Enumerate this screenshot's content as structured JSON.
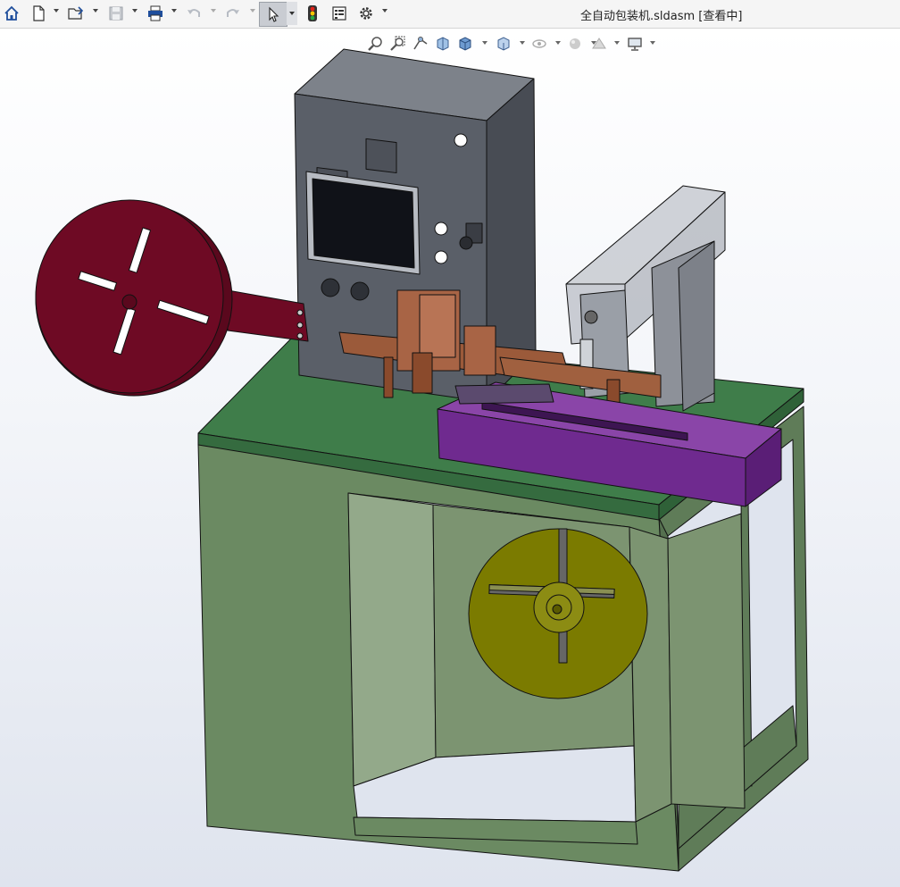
{
  "window": {
    "title": "全自动包装机.sldasm [查看中]"
  },
  "toolbar": {
    "items": [
      {
        "name": "home-icon"
      },
      {
        "name": "new-document-icon"
      },
      {
        "name": "open-icon"
      },
      {
        "name": "save-icon"
      },
      {
        "name": "print-icon"
      },
      {
        "name": "undo-icon"
      },
      {
        "name": "redo-icon"
      },
      {
        "name": "select-pointer-icon",
        "state": "active"
      },
      {
        "name": "rebuild-traffic-light-icon"
      },
      {
        "name": "file-properties-icon"
      },
      {
        "name": "options-gear-icon"
      }
    ]
  },
  "headsup_toolbar": {
    "items": [
      "zoom-to-fit-icon",
      "zoom-to-area-icon",
      "previous-view-icon",
      "section-view-icon",
      "view-orientation-icon",
      "display-style-icon",
      "hide-show-items-icon",
      "edit-appearance-icon",
      "apply-scene-icon",
      "view-settings-monitor-icon"
    ]
  },
  "colors": {
    "frame_panel": "#6b8a62",
    "table_top": "#3f7d4a",
    "control_box": "#5a5f68",
    "reel_left": "#6e0a24",
    "reel_right": "#7b7b00",
    "conveyor": "#6f2a8f",
    "copper_parts": "#9b5a3a",
    "feeder_cover": "#b9bec6"
  }
}
